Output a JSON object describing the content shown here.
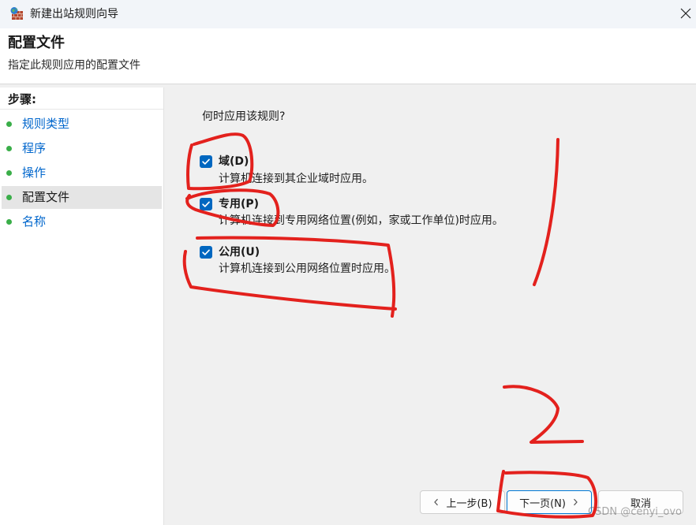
{
  "window": {
    "title": "新建出站规则向导",
    "icon": "firewall-icon",
    "close_icon": "close-icon"
  },
  "header": {
    "title": "配置文件",
    "subtitle": "指定此规则应用的配置文件"
  },
  "steps": {
    "heading": "步骤:",
    "items": [
      {
        "label": "规则类型",
        "state": "link"
      },
      {
        "label": "程序",
        "state": "link"
      },
      {
        "label": "操作",
        "state": "link"
      },
      {
        "label": "配置文件",
        "state": "current"
      },
      {
        "label": "名称",
        "state": "link"
      }
    ]
  },
  "content": {
    "question": "何时应用该规则?",
    "options": [
      {
        "label": "域(D)",
        "description": "计算机连接到其企业域时应用。",
        "checked": true
      },
      {
        "label": "专用(P)",
        "description": "计算机连接到专用网络位置(例如，家或工作单位)时应用。",
        "checked": true
      },
      {
        "label": "公用(U)",
        "description": "计算机连接到公用网络位置时应用。",
        "checked": true
      }
    ]
  },
  "buttons": {
    "back": "上一步(B)",
    "back_icon": "chevron-left-icon",
    "next": "下一页(N)",
    "next_icon": "chevron-right-icon",
    "cancel": "取消"
  },
  "watermark": "CSDN @cenyi_ovo",
  "annotations": {
    "color": "#e3211d",
    "labels": [
      "1",
      "2"
    ]
  },
  "colors": {
    "link": "#0066cc",
    "checkbox": "#0067c0",
    "dot": "#3aae49",
    "selected": "#e5e5e5",
    "pane": "#f0f0f0"
  }
}
